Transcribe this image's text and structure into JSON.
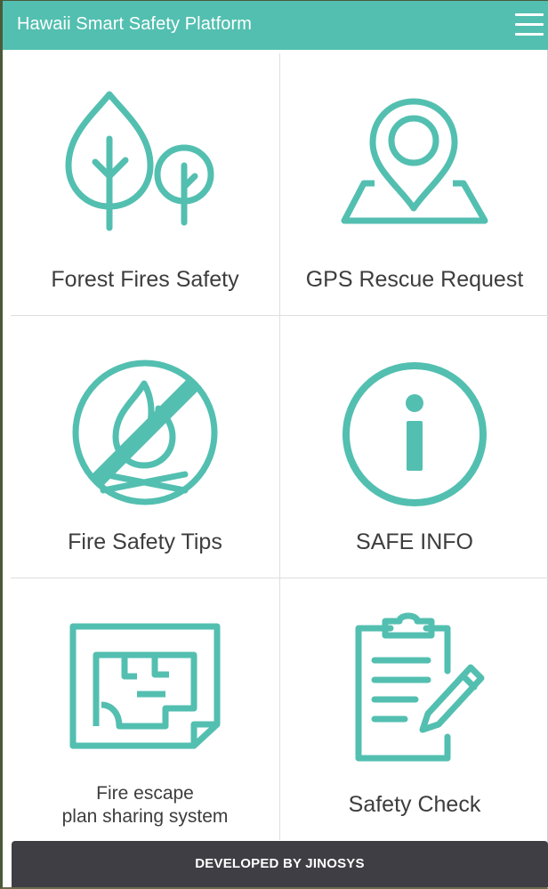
{
  "header": {
    "title": "Hawaii Smart Safety Platform",
    "menu_icon": "hamburger-menu-icon"
  },
  "tiles": [
    {
      "label": "Forest Fires Safety",
      "icon": "trees-icon"
    },
    {
      "label": "GPS Rescue Request",
      "icon": "map-pin-icon"
    },
    {
      "label": "Fire Safety Tips",
      "icon": "no-fire-icon"
    },
    {
      "label": "SAFE INFO",
      "icon": "info-icon"
    },
    {
      "label_line1": "Fire escape",
      "label_line2": "plan sharing system",
      "icon": "floor-plan-icon"
    },
    {
      "label": "Safety Check",
      "icon": "clipboard-checklist-icon"
    }
  ],
  "footer": {
    "text": "DEVELOPED BY JINOSYS"
  },
  "colors": {
    "accent": "#53bfb0",
    "footer_bg": "#3e3e44",
    "label_text": "#3d3d3d"
  }
}
